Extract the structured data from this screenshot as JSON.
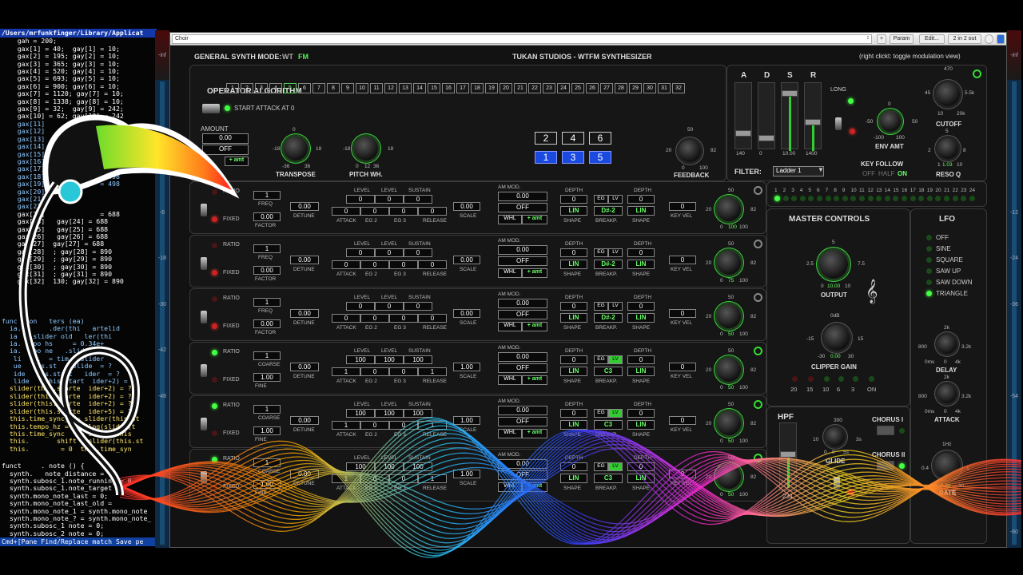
{
  "code": {
    "path": "/Users/mrfunkfinger/Library/Applicat",
    "lines": [
      "    gah = 200;",
      "    gax[1] = 40;  gay[1] = 10;",
      "    gax[2] = 195; gay[2] = 10;",
      "    gax[3] = 365; gay[3] = 10;",
      "    gax[4] = 520; gay[4] = 10;",
      "    gax[5] = 693; gay[5] = 10;",
      "    gax[6] = 900; gay[6] = 10;",
      "    gax[7] = 1120; gay[7] = 10;",
      "    gax[8] = 1338; gay[8] = 10;",
      "    gax[9] = 32;  gay[9] = 242;",
      "    gax[10] = 62; gay[10] = 242",
      "    gax[11]",
      "    gax[12]",
      "    gax[13]",
      "    gax[14]",
      "    gax[15]",
      "    gax[16]",
      "    gax[17]              = 498",
      "    gax[18]              = 498",
      "    gax[19]              = 498",
      "    gax[20]",
      "    gax[21]",
      "    gax[22]",
      "    gax[23]              = 688",
      "    gax[24]   gay[24] = 688",
      "    gax[25]   gay[25] = 688",
      "    gax[26]   gay[26] = 688",
      "    gax[27]  gay[27] = 688",
      "    gax[28]  ; gay[28] = 890",
      "    gax[29]  ; gay[29] = 890",
      "    gax[30]  ; gay[30] = 890",
      "    gax[31]  ; gay[31] = 890",
      "    gax[32]  130; gay[32] = 890"
    ],
    "lines2": [
      "func   on   ters (ea)",
      "  ia.       .der(thi   artelid",
      "  ia   .slider old   ler(thi",
      "  ia.   po hs     = 0.34e+",
      "  ia.   po ne   .slider(thi",
      "   li   t.  = tim   slider",
      "   ue   his.st   telide  = ?",
      "   ide   his.start   ider  = ?",
      "   lide   (this.start  ider+2) = ?",
      "  slider(this.starte  ider+2) = ?",
      "  slider(this.starte  ider+2) = ?",
      "  slider(this.starte  ider+2) = ?",
      "  slider(this.starte  ider+5) = ?",
      "  this.time_sync_2 = slider(this.st",
      "  this.tempo_hz = exp2log(slider(t",
      "  this.time_sync    = slider(this",
      "  this.       shift = slider(this.st",
      "  this.        = 0  this.time_syn"
    ],
    "lines3": [
      "funct     . note () {",
      "  synth.   note_distance = 0",
      "  synth.subosc_1.note_running = 0",
      "  synth.subosc_1.note_target",
      "  synth.mono_note_last = 0;",
      "  synth.mono_note_last_old =",
      "  synth.mono_note_1 = synth.mono_note",
      "  synth.mono_note_? = synth.mono_note_",
      "  synth.subosc_1 note = 0;",
      "  synth.subosc_2 note = 0;"
    ],
    "footer": "Cmd+[Pane Find/Replace match Save pe"
  },
  "toolbar": {
    "preset": "Choir",
    "param": "Param",
    "edit": "Edit...",
    "io": "2 in 2 out",
    "plus": "+",
    "arrows": "↕"
  },
  "header": {
    "mode_label": "GENERAL SYNTH MODE:",
    "mode_wt": "WT",
    "mode_fm": "FM",
    "title": "TUKAN STUDIOS  -  WTFM SYNTHESIZER",
    "hint": "(right clickt: toggle modulation view)"
  },
  "algorithm": {
    "title": "OPERATOR ALGORITHM",
    "numbers": [
      "1",
      "2",
      "3",
      "4",
      "5",
      "6",
      "7",
      "8",
      "9",
      "10",
      "11",
      "12",
      "13",
      "14",
      "15",
      "16",
      "17",
      "18",
      "19",
      "20",
      "21",
      "22",
      "23",
      "24",
      "25",
      "26",
      "27",
      "28",
      "29",
      "30",
      "31",
      "32"
    ],
    "selected": "5",
    "start_attack": "START ATTACK AT 0",
    "amount": "AMOUNT",
    "amount_val": "0.00",
    "off": "OFF",
    "amt": "+ amt",
    "ops_top": [
      "2",
      "4",
      "6"
    ],
    "ops_bot": [
      "1",
      "3",
      "5"
    ],
    "transpose": "TRANSPOSE",
    "pitch": "PITCH WH.",
    "feedback": "FEEDBACK",
    "tr_min": "-18",
    "tr_max": "18",
    "tr_low": "-36",
    "tr_high": "36",
    "tr_zero": "0",
    "pw_min": "-18",
    "pw_max": "18",
    "pw_low": "0",
    "pw_mid": "12",
    "pw_high": "36",
    "fb_min": "20",
    "fb_mid": "50",
    "fb_max": "82",
    "fb_low": "0",
    "fb_high": "100"
  },
  "adsr": {
    "labels": [
      "A",
      "D",
      "S",
      "R"
    ],
    "values": [
      "140",
      "0",
      "10.00",
      "1400"
    ],
    "long": "LONG",
    "filter": "FILTER:",
    "filter_type": "Ladder 1",
    "env_amt": "ENV AMT",
    "env_min": "-100",
    "env_max": "100",
    "env_l": "-50",
    "env_r": "50",
    "env_zero": "0",
    "cutoff": "CUTOFF",
    "cut_top": "470",
    "cut_l": "45",
    "cut_r": "5.5k",
    "cut_bl": "10",
    "cut_b": "20k",
    "reso": "RESO Q",
    "reso_top": "5",
    "reso_l": "2",
    "reso_r": "8",
    "reso_b": "1.03",
    "reso_bl": "1",
    "reso_br": "10",
    "key_follow": "KEY FOLLOW",
    "kf_off": "OFF",
    "kf_half": "HALF",
    "kf_on": "ON"
  },
  "channels": [
    "1",
    "2",
    "3",
    "4",
    "5",
    "6",
    "7",
    "8",
    "9",
    "10",
    "11",
    "12",
    "13",
    "14",
    "15",
    "16",
    "17",
    "18",
    "19",
    "20",
    "21",
    "22",
    "23",
    "24"
  ],
  "operators": [
    {
      "freq": "1",
      "freq_label": "FREQ",
      "factor": "0.00",
      "factor_label": "FACTOR",
      "detune": "0.00",
      "levels": [
        "0",
        "0",
        "0"
      ],
      "eg": [
        "0",
        "0",
        "0",
        "0"
      ],
      "scale": "0.00",
      "am": "0.00",
      "am_off": "OFF",
      "depth1": "0",
      "depth2": "0",
      "breakp": "D#-2",
      "shape1": "LIN",
      "shape2": "LIN",
      "keyvel": "0",
      "ratio_on": false,
      "gain_val": "100"
    },
    {
      "freq": "1",
      "freq_label": "FREQ",
      "factor": "0.00",
      "factor_label": "FACTOR",
      "detune": "0.00",
      "levels": [
        "0",
        "0",
        "0"
      ],
      "eg": [
        "0",
        "0",
        "0",
        "0"
      ],
      "scale": "0.00",
      "am": "0.00",
      "am_off": "OFF",
      "depth1": "0",
      "depth2": "0",
      "breakp": "D#-2",
      "shape1": "LIN",
      "shape2": "LIN",
      "keyvel": "0",
      "ratio_on": false,
      "gain_val": "75"
    },
    {
      "freq": "1",
      "freq_label": "FREQ",
      "factor": "0.00",
      "factor_label": "FACTOR",
      "detune": "0.00",
      "levels": [
        "0",
        "0",
        "0"
      ],
      "eg": [
        "0",
        "0",
        "0",
        "0"
      ],
      "scale": "0.00",
      "am": "0.00",
      "am_off": "OFF",
      "depth1": "0",
      "depth2": "0",
      "breakp": "D#-2",
      "shape1": "LIN",
      "shape2": "LIN",
      "keyvel": "0",
      "ratio_on": false,
      "gain_val": "50"
    },
    {
      "freq": "1",
      "freq_label": "COARSE",
      "factor": "1.00",
      "factor_label": "FINE",
      "detune": "0.00",
      "levels": [
        "100",
        "100",
        "100"
      ],
      "eg": [
        "1",
        "0",
        "0",
        "1"
      ],
      "scale": "1.00",
      "am": "0.00",
      "am_off": "OFF",
      "depth1": "0",
      "depth2": "0",
      "breakp": "C3",
      "shape1": "LIN",
      "shape2": "LIN",
      "keyvel": "0",
      "ratio_on": true,
      "gain_val": "50"
    },
    {
      "freq": "1",
      "freq_label": "COARSE",
      "factor": "1.00",
      "factor_label": "FINE",
      "detune": "0.00",
      "levels": [
        "100",
        "100",
        "100"
      ],
      "eg": [
        "1",
        "0",
        "0",
        "1"
      ],
      "scale": "1.00",
      "am": "0.00",
      "am_off": "OFF",
      "depth1": "0",
      "depth2": "0",
      "breakp": "C3",
      "shape1": "LIN",
      "shape2": "LIN",
      "keyvel": "0",
      "ratio_on": true,
      "gain_val": "50"
    },
    {
      "freq": "1",
      "freq_label": "COARSE",
      "factor": "1.00",
      "factor_label": "FINE",
      "detune": "0.00",
      "levels": [
        "100",
        "100",
        "100"
      ],
      "eg": [
        "1",
        "0",
        "0",
        "1"
      ],
      "scale": "1.00",
      "am": "0.00",
      "am_off": "OFF",
      "depth1": "0",
      "depth2": "0",
      "breakp": "C3",
      "shape1": "LIN",
      "shape2": "LIN",
      "keyvel": "0",
      "ratio_on": true,
      "gain_val": "50"
    }
  ],
  "op_labels": {
    "ratio": "RATIO",
    "fixed": "FIXED",
    "detune": "DETUNE",
    "level": "LEVEL",
    "sustain": "SUSTAIN",
    "attack": "ATTACK",
    "eg2": "EG 2",
    "eg3": "EG 3",
    "release": "RELEASE",
    "scale": "SCALE",
    "ammod": "AM MOD.",
    "whl": "WHL",
    "amt": "+ amt",
    "depth": "DEPTH",
    "eg": "EG",
    "lv": "LV",
    "shape": "SHAPE",
    "breakp": "BREAKP.",
    "keyvel": "KEY VEL",
    "k_min": "20",
    "k_max": "82",
    "k_top": "50",
    "k_low": "0",
    "k_high": "100"
  },
  "master": {
    "title": "MASTER CONTROLS",
    "output": "OUTPUT",
    "out_l": "2.5",
    "out_r": "7.5",
    "out_top": "5",
    "out_bl": "0",
    "out_b": "10.00",
    "out_br": "10",
    "clipper": "CLIPPER GAIN",
    "clip_top": "0dB",
    "clip_l": "-15",
    "clip_r": "15",
    "clip_bl": "-30",
    "clip_b": "0.00",
    "clip_br": "30",
    "levels": [
      "20",
      "15",
      "10",
      "6",
      "3",
      "ON"
    ]
  },
  "lfo": {
    "title": "LFO",
    "options": [
      "OFF",
      "SINE",
      "SQUARE",
      "SAW UP",
      "SAW DOWN",
      "TRIANGLE"
    ],
    "selected": "TRIANGLE",
    "delay": "DELAY",
    "delay_top": "2k",
    "delay_l": "800",
    "delay_r": "3.2k",
    "delay_bl": "0ms",
    "delay_b": "0",
    "delay_br": "4k",
    "attack": "ATTACK",
    "att_top": "2k",
    "att_l": "800",
    "att_r": "3.2k",
    "att_bl": "0ms",
    "att_b": "0",
    "att_br": "4k",
    "rate": "RATE",
    "rate_top": "1Hz",
    "rate_l": "0.4",
    "rate_r": "1",
    "rate_b": "0.39",
    "rate_bl": "0.3",
    "rate_br": "30"
  },
  "hpf": {
    "title": "HPF",
    "value": "231",
    "chorus1": "CHORUS I",
    "chorus2": "CHORUS II",
    "glide": "GLIDE",
    "glide_top": "300",
    "glide_l": "10",
    "glide_r": "3s",
    "glide_bl": "0",
    "glide_b": "0",
    "glide_br": "5s"
  },
  "meter_marks": [
    "-inf",
    "-inf",
    "-6",
    "-12",
    "-18",
    "-24",
    "-30",
    "-36",
    "-42",
    "-48",
    "-54",
    "-60"
  ]
}
